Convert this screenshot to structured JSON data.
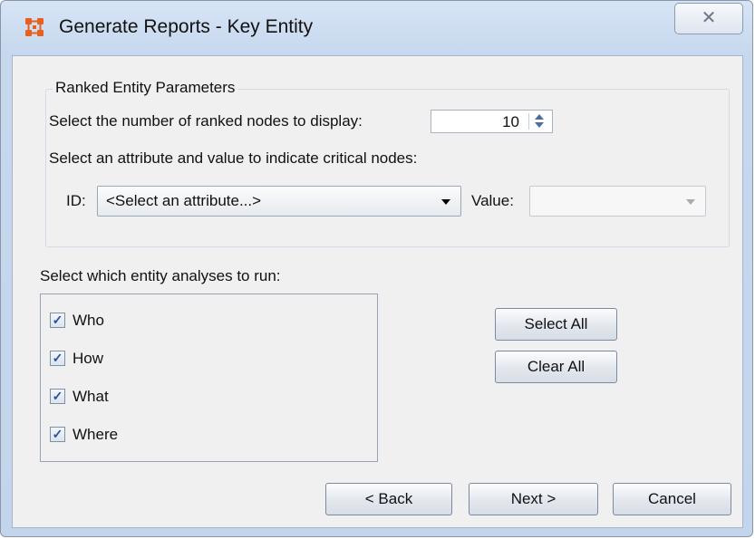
{
  "window": {
    "title": "Generate Reports - Key Entity",
    "close_glyph": "✕"
  },
  "ranked": {
    "group_label": "Ranked Entity Parameters",
    "num_nodes_label": "Select the number of ranked nodes to display:",
    "num_nodes_value": "10",
    "attribute_prompt": "Select an attribute and value to indicate critical nodes:",
    "id_label": "ID:",
    "id_selected": "<Select an attribute...>",
    "value_label": "Value:",
    "value_selected": ""
  },
  "analyses": {
    "label": "Select which entity analyses to run:",
    "items": [
      {
        "label": "Who",
        "checked": true
      },
      {
        "label": "How",
        "checked": true
      },
      {
        "label": "What",
        "checked": true
      },
      {
        "label": "Where",
        "checked": true
      }
    ],
    "check_glyph": "✓",
    "select_all_label": "Select All",
    "clear_all_label": "Clear All"
  },
  "footer": {
    "back_label": "< Back",
    "next_label": "Next >",
    "cancel_label": "Cancel"
  }
}
